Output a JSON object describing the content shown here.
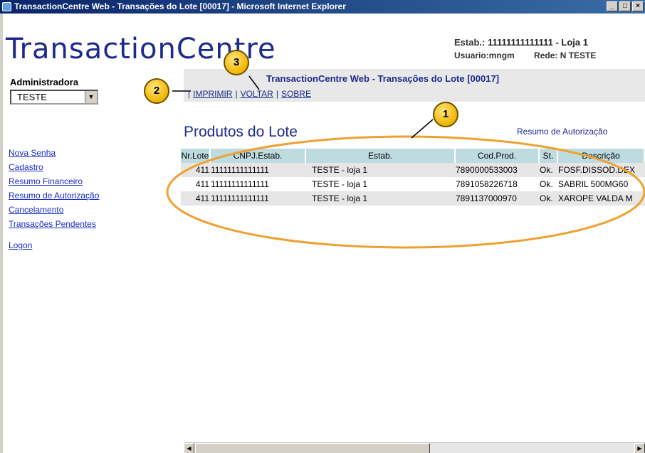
{
  "window": {
    "title": "TransactionCentre Web - Transações do Lote [00017] - Microsoft Internet Explorer",
    "controls": [
      "_",
      "□",
      "×"
    ]
  },
  "header": {
    "logo": "TransactionCentre",
    "estab_label": "Estab.:",
    "estab_value": "11111111111111 - Loja 1",
    "usuario_label": "Usuario:",
    "usuario_value": "mngm",
    "rede_label": "Rede:",
    "rede_value": "N TESTE"
  },
  "sidebar": {
    "admin_label": "Administradora",
    "admin_selected": "TESTE",
    "items": [
      {
        "label": "Nova Senha"
      },
      {
        "label": "Cadastro"
      },
      {
        "label": "Resumo Financeiro"
      },
      {
        "label": "Resumo de Autorização"
      },
      {
        "label": "Cancelamento"
      },
      {
        "label": "Transações Pendentes"
      },
      {
        "label": "Logon"
      }
    ]
  },
  "topbar": {
    "heading": "TransactionCentre Web - Transações do Lote [00017]",
    "links": [
      "IMPRIMIR",
      "VOLTAR",
      "SOBRE"
    ]
  },
  "main": {
    "title": "Produtos do Lote",
    "resumo_link": "Resumo de Autorização",
    "columns": [
      "Nr.Lote",
      "CNPJ.Estab.",
      "Estab.",
      "Cod.Prod.",
      "St.",
      "Descrição"
    ],
    "rows": [
      {
        "lote": "411",
        "cnpj": "11111111111111",
        "estab": "TESTE - loja 1",
        "cod": "7890000533003",
        "st": "Ok.",
        "desc": "FOSF.DISSOD.DEX"
      },
      {
        "lote": "411",
        "cnpj": "11111111111111",
        "estab": "TESTE - loja 1",
        "cod": "7891058226718",
        "st": "Ok.",
        "desc": "SABRIL 500MG60"
      },
      {
        "lote": "411",
        "cnpj": "11111111111111",
        "estab": "TESTE - loja 1",
        "cod": "7891137000970",
        "st": "Ok.",
        "desc": "XAROPE VALDA M"
      }
    ]
  },
  "callouts": [
    "1",
    "2",
    "3"
  ],
  "colors": {
    "accent": "#1c2a8c",
    "header_row": "#bedbe0",
    "callout": "#f2b400",
    "ellipse": "#f0a030"
  }
}
